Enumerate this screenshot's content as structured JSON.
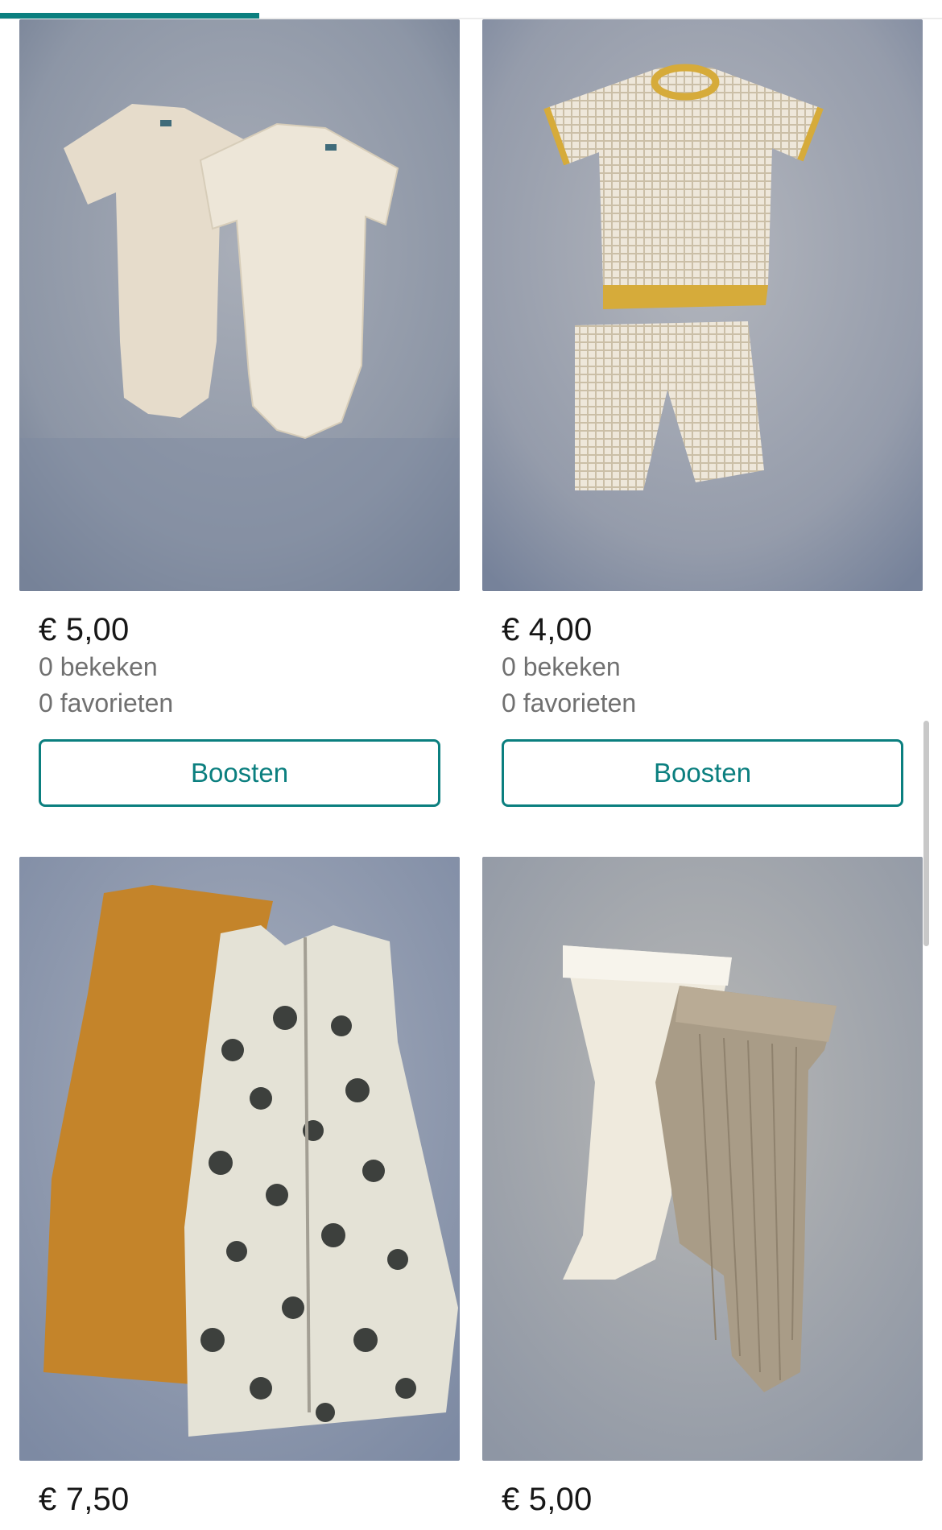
{
  "upload_progress": 0.275,
  "colors": {
    "accent": "#0b7f7f",
    "muted_text": "#707070"
  },
  "listings": [
    {
      "price": "€ 5,00",
      "views": "0 bekeken",
      "favorites": "0 favorieten",
      "boost_label": "Boosten",
      "photo": "two cream ribbed baby bodysuits on grey fleece"
    },
    {
      "price": "€ 4,00",
      "views": "0 bekeken",
      "favorites": "0 favorieten",
      "boost_label": "Boosten",
      "photo": "checked tee with yellow trim and shorts set"
    },
    {
      "price": "€ 7,50",
      "photo": "ochre and spotted baby sleeping bags"
    },
    {
      "price": "€ 5,00",
      "photo": "cream and taupe ribbed footed leggings"
    }
  ]
}
